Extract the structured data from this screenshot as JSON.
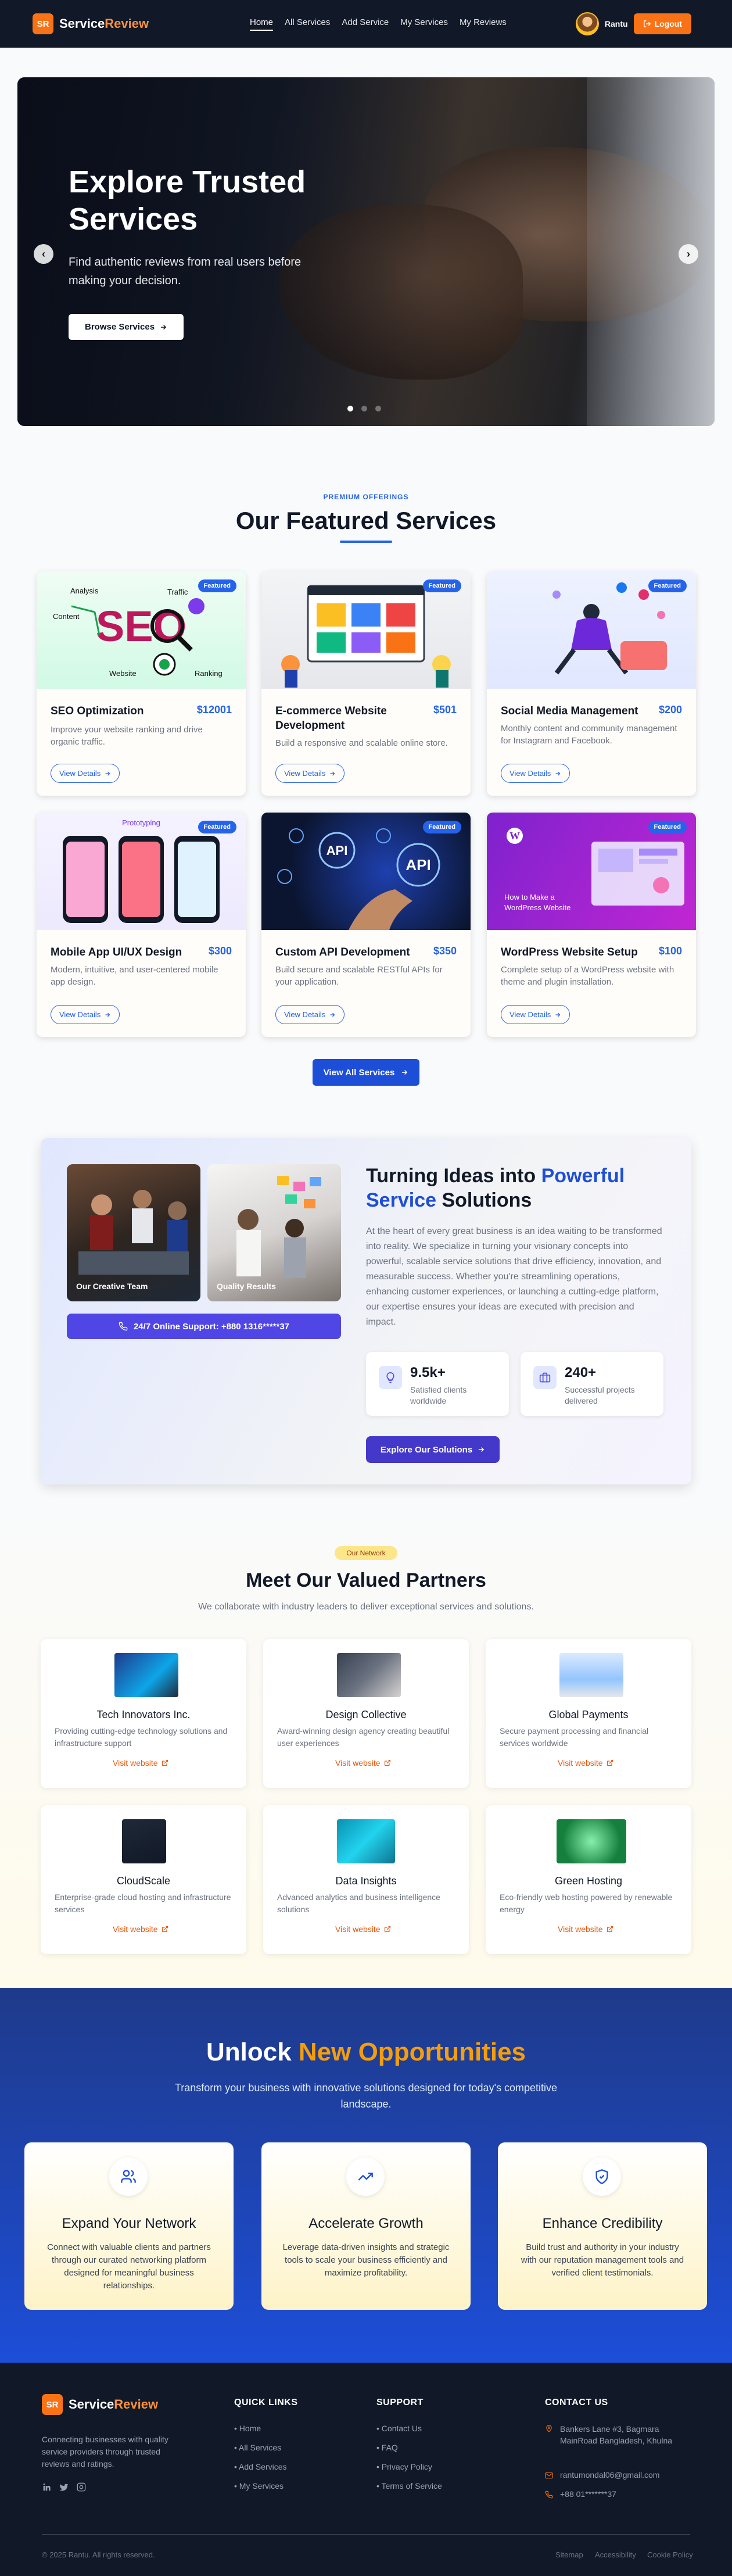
{
  "nav": {
    "logo_badge": "SR",
    "logo_main": "Service",
    "logo_accent": "Review",
    "links": [
      "Home",
      "All Services",
      "Add Service",
      "My Services",
      "My Reviews"
    ],
    "user_name": "Rantu",
    "logout_label": "Logout"
  },
  "hero": {
    "title": "Explore Trusted Services",
    "subtitle": "Find authentic reviews from real users before making your decision.",
    "button": "Browse Services",
    "prev_icon": "‹",
    "next_icon": "›"
  },
  "featured": {
    "eyebrow": "PREMIUM OFFERINGS",
    "title": "Our Featured Services",
    "badge": "Featured",
    "details_label": "View Details",
    "cards": [
      {
        "title": "SEO Optimization",
        "price": "$12001",
        "desc": "Improve your website ranking and drive organic traffic."
      },
      {
        "title": "E-commerce Website Development",
        "price": "$501",
        "desc": "Build a responsive and scalable online store."
      },
      {
        "title": "Social Media Management",
        "price": "$200",
        "desc": "Monthly content and community management for Instagram and Facebook."
      },
      {
        "title": "Mobile App UI/UX Design",
        "price": "$300",
        "desc": "Modern, intuitive, and user-centered mobile app design."
      },
      {
        "title": "Custom API Development",
        "price": "$350",
        "desc": "Build secure and scalable RESTful APIs for your application."
      },
      {
        "title": "WordPress Website Setup",
        "price": "$100",
        "desc": "Complete setup of a WordPress website with theme and plugin installation."
      }
    ],
    "img_text": {
      "seo": "SEO",
      "seo_words": [
        "Analysis",
        "Traffic",
        "Content",
        "Website",
        "Ranking"
      ],
      "proto": "Prototyping",
      "api": "API",
      "wp_line1": "How to Make a",
      "wp_line2": "WordPress Website"
    },
    "view_all": "View All Services"
  },
  "ideas": {
    "photo1_caption": "Our Creative Team",
    "photo2_caption": "Quality Results",
    "support": "24/7 Online Support: +880 1316*****37",
    "title_a": "Turning Ideas into ",
    "title_accent": "Powerful Service",
    "title_b": " Solutions",
    "text": "At the heart of every great business is an idea waiting to be transformed into reality. We specialize in turning your visionary concepts into powerful, scalable service solutions that drive efficiency, innovation, and measurable success. Whether you're streamlining operations, enhancing customer experiences, or launching a cutting-edge platform, our expertise ensures your ideas are executed with precision and impact.",
    "stats": [
      {
        "value": "9.5k+",
        "label": "Satisfied clients worldwide"
      },
      {
        "value": "240+",
        "label": "Successful projects delivered"
      }
    ],
    "button": "Explore Our Solutions"
  },
  "partners": {
    "pill": "Our Network",
    "title": "Meet Our Valued Partners",
    "subtitle": "We collaborate with industry leaders to deliver exceptional services and solutions.",
    "link_label": "Visit website",
    "items": [
      {
        "name": "Tech Innovators Inc.",
        "desc": "Providing cutting-edge technology solutions and infrastructure support"
      },
      {
        "name": "Design Collective",
        "desc": "Award-winning design agency creating beautiful user experiences"
      },
      {
        "name": "Global Payments",
        "desc": "Secure payment processing and financial services worldwide"
      },
      {
        "name": "CloudScale",
        "desc": "Enterprise-grade cloud hosting and infrastructure services"
      },
      {
        "name": "Data Insights",
        "desc": "Advanced analytics and business intelligence solutions"
      },
      {
        "name": "Green Hosting",
        "desc": "Eco-friendly web hosting powered by renewable energy"
      }
    ]
  },
  "unlock": {
    "title_a": "Unlock ",
    "title_accent": "New Opportunities",
    "subtitle": "Transform your business with innovative solutions designed for today's competitive landscape.",
    "cards": [
      {
        "title": "Expand Your Network",
        "desc": "Connect with valuable clients and partners through our curated networking platform designed for meaningful business relationships.",
        "icon": "users-icon"
      },
      {
        "title": "Accelerate Growth",
        "desc": "Leverage data-driven insights and strategic tools to scale your business efficiently and maximize profitability.",
        "icon": "trending-up-icon"
      },
      {
        "title": "Enhance Credibility",
        "desc": "Build trust and authority in your industry with our reputation management tools and verified client testimonials.",
        "icon": "shield-check-icon"
      }
    ]
  },
  "footer": {
    "desc": "Connecting businesses with quality service providers through trusted reviews and ratings.",
    "quick_title": "QUICK LINKS",
    "quick": [
      "Home",
      "All Services",
      "Add Services",
      "My Services"
    ],
    "support_title": "SUPPORT",
    "support": [
      "Contact Us",
      "FAQ",
      "Privacy Policy",
      "Terms of Service"
    ],
    "contact_title": "CONTACT US",
    "address": "Bankers Lane #3, Bagmara MainRoad Bangladesh, Khulna",
    "email": "rantumondal06@gmail.com",
    "phone": "+88 01*******37",
    "copyright": "© 2025 Rantu. All rights reserved.",
    "legal": [
      "Sitemap",
      "Accessibility",
      "Cookie Policy"
    ]
  },
  "colors": {
    "brand": "#f97316",
    "primary": "#2563eb",
    "dark": "#111827",
    "unlock_bg": "#1d4ed8"
  }
}
